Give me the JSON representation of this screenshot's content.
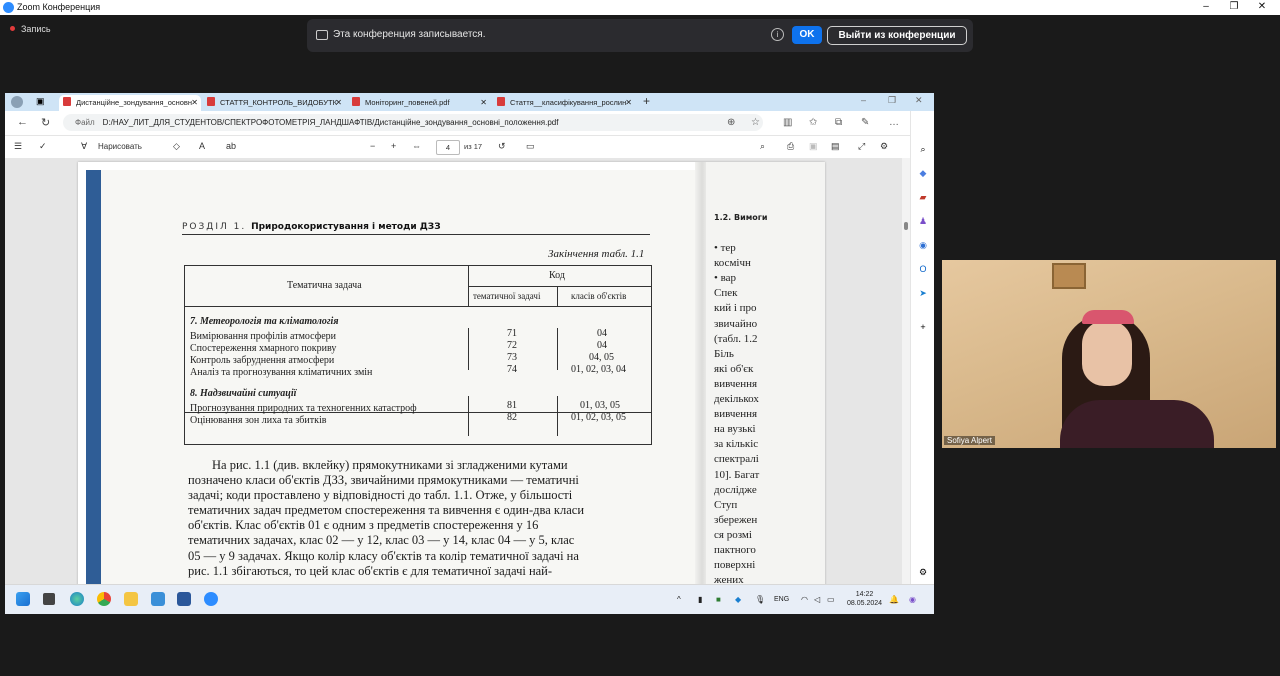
{
  "zoom": {
    "window_title": "Zoom Конференция",
    "recording_label": "Запись",
    "banner_text": "Эта конференция записывается.",
    "ok_button": "OK",
    "leave_button": "Выйти из конференции",
    "participant_name": "Sofiya Alpert"
  },
  "browser": {
    "tabs": [
      {
        "label": "Дистанційне_зондування_основн",
        "active": true
      },
      {
        "label": "СТАТТЯ_КОНТРОЛЬ_ВИДОБУТК",
        "active": false
      },
      {
        "label": "Моніторинг_повеней.pdf",
        "active": false
      },
      {
        "label": "Стаття__класифікування_рослин",
        "active": false
      }
    ],
    "address_label": "Файл",
    "address": "D:/НАУ_ЛИТ_ДЛЯ_СТУДЕНТОВ/СПЕКТРОФОТОМЕТРІЯ_ЛАНДШАФТІВ/Дистанційне_зондування_основні_положення.pdf"
  },
  "pdf_toolbar": {
    "draw_label": "Нарисовать",
    "page_current": "4",
    "page_total": "из 17"
  },
  "doc": {
    "section_prefix": "РОЗДІЛ 1.",
    "section_title": "Природокористування і методи ДЗЗ",
    "table_caption": "Закінчення табл. 1.1",
    "col_task": "Тематична задача",
    "col_code": "Код",
    "col_task_code": "тематичної задачі",
    "col_class": "класів об'єктів",
    "section7": "7. Метеорологія та кліматологія",
    "rows7": [
      {
        "task": "Вимірювання профілів атмосфери",
        "code": "71",
        "classes": "04"
      },
      {
        "task": "Спостереження хмарного покриву",
        "code": "72",
        "classes": "04"
      },
      {
        "task": "Контроль забруднення атмосфери",
        "code": "73",
        "classes": "04, 05"
      },
      {
        "task": "Аналіз та прогнозування кліматичних змін",
        "code": "74",
        "classes": "01, 02, 03, 04"
      }
    ],
    "section8": "8. Надзвичайні ситуації",
    "rows8": [
      {
        "task": "Прогнозування природних та техногенних катастроф",
        "code": "81",
        "classes": "01, 03, 05"
      },
      {
        "task": "Оцінювання зон лиха та збитків",
        "code": "82",
        "classes": "01, 02, 03, 05"
      }
    ],
    "paragraph": [
      "На рис. 1.1 (див. вклейку) прямокутниками зі згладженими кутами",
      "позначено класи об'єктів ДЗЗ, звичайними прямокутниками — тематичні",
      "задачі; коди проставлено у відповідності до табл. 1.1. Отже, у більшості",
      "тематичних задач предметом спостереження та вивчення є один-два класи",
      "об'єктів. Клас об'єктів 01 є одним з предметів спостереження у 16",
      "тематичних задачах, клас 02 — у 12, клас 03 — у 14, клас 04 — у 5, клас",
      "05 — у 9 задачах. Якщо колір класу об'єктів та колір тематичної задачі на",
      "рис. 1.1 збігаються, то цей клас об'єктів є для тематичної задачі най-"
    ],
    "right_header": "1.2. Вимоги",
    "right_lines": [
      "• тер",
      "космічн",
      "• вар",
      "Спек",
      "кий і про",
      "звичайно",
      "(табл. 1.2",
      "Біль",
      "які об'єк",
      "вивчення",
      "декількох",
      "вивчення",
      "на вузькі",
      "за кількіс",
      "спектралі",
      "10]. Багат",
      "дослідже",
      "Ступ",
      "збережен",
      "ся розмі",
      "пактного",
      "поверхні",
      "жених"
    ]
  },
  "taskbar": {
    "lang": "ENG",
    "time": "14:22",
    "date": "08.05.2024"
  }
}
